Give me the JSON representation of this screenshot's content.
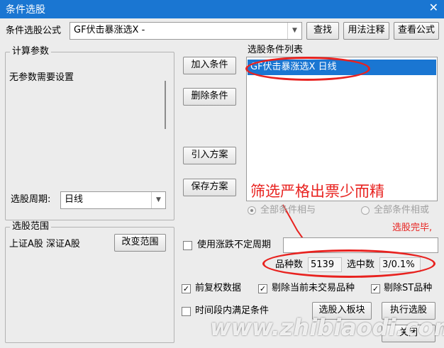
{
  "window": {
    "title": "条件选股",
    "close_glyph": "✕"
  },
  "formula": {
    "label": "条件选股公式",
    "value": "GF伏击暴涨选X  -",
    "search_button": "查找",
    "usage_button": "用法注释",
    "view_button": "查看公式"
  },
  "params": {
    "legend": "计算参数",
    "message": "无参数需要设置"
  },
  "period": {
    "label": "选股周期:",
    "value": "日线"
  },
  "range": {
    "legend": "选股范围",
    "value": "上证A股 深证A股",
    "change_button": "改变范围"
  },
  "condition_buttons": {
    "add": "加入条件",
    "delete": "删除条件",
    "import": "引入方案",
    "save": "保存方案"
  },
  "condition_list": {
    "label": "选股条件列表",
    "items": [
      {
        "text": "GF伏击暴涨选X  日线"
      }
    ]
  },
  "annotation": "筛选严格出票少而精",
  "logic": {
    "all_and": "全部条件相与",
    "all_or": "全部条件相或",
    "selected": "all_and"
  },
  "status_text": "选股完毕,",
  "variable_period": {
    "label": "使用涨跌不定周期",
    "checked": false,
    "value": ""
  },
  "stats": {
    "count_label": "品种数",
    "count_value": "5139",
    "selected_label": "选中数",
    "selected_value": "3/0.1%"
  },
  "options": {
    "pre_adjust": {
      "label": "前复权数据",
      "checked": true
    },
    "exclude_untraded": {
      "label": "剔除当前未交易品种",
      "checked": true
    },
    "exclude_st": {
      "label": "剔除ST品种",
      "checked": true
    },
    "time_range": {
      "label": "时间段内满足条件",
      "checked": false
    }
  },
  "actions": {
    "to_block": "选股入板块",
    "execute": "执行选股",
    "close": "关闭"
  },
  "watermark": "www.zhibiaodi.com",
  "colors": {
    "titlebar": "#1a76d2",
    "selection": "#1a76d2",
    "annotation_red": "#e8221f",
    "status_red": "#e8221f"
  }
}
